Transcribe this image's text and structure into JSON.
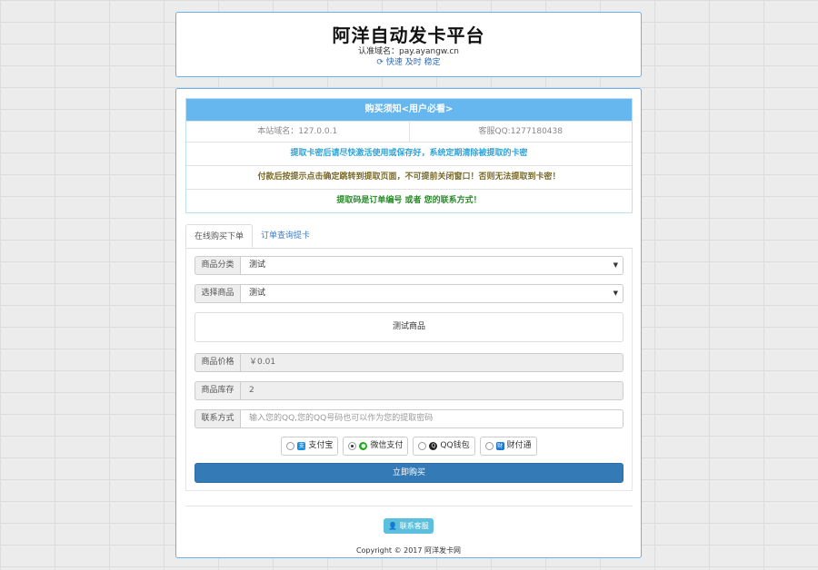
{
  "header": {
    "title": "阿洋自动发卡平台",
    "domain": "认准域名：pay.ayangw.cn",
    "tags": "快速 及时 稳定"
  },
  "notice": {
    "heading": "购买须知<用户必看>",
    "site_domain": "本站域名：127.0.0.1",
    "service_qq": "客服QQ:1277180438",
    "lines": [
      {
        "text": "提取卡密后请尽快激活使用或保存好，系统定期清除被提取的卡密",
        "color": "#31a3d8"
      },
      {
        "text": "付款后按提示点击确定跳转到提取页面，不可提前关闭窗口！否则无法提取到卡密！",
        "color": "#7a6a2a"
      },
      {
        "text": "提取码是订单编号 或者 您的联系方式！",
        "color": "#2a8a2a"
      }
    ]
  },
  "tabs": [
    "在线购买下单",
    "订单查询提卡"
  ],
  "form": {
    "category_label": "商品分类",
    "category_value": "测试",
    "product_label": "选择商品",
    "product_value": "测试",
    "description": "测试商品",
    "price_label": "商品价格",
    "price_value": "￥0.01",
    "stock_label": "商品库存",
    "stock_value": "2",
    "contact_label": "联系方式",
    "contact_placeholder": "输入您的QQ,您的QQ号码也可以作为您的提取密码"
  },
  "payments": [
    {
      "label": "支付宝",
      "icon": "alipay-icon",
      "color": "#1e90e0",
      "selected": false
    },
    {
      "label": "微信支付",
      "icon": "wechat-icon",
      "color": "#1aad19",
      "selected": true
    },
    {
      "label": "QQ钱包",
      "icon": "qq-icon",
      "color": "#222222",
      "selected": false
    },
    {
      "label": "财付通",
      "icon": "tenpay-icon",
      "color": "#1e78d0",
      "selected": false
    }
  ],
  "buy_label": "立即购买",
  "contact_button": "联系客服",
  "footer": "Copyright © 2017 阿洋发卡网"
}
